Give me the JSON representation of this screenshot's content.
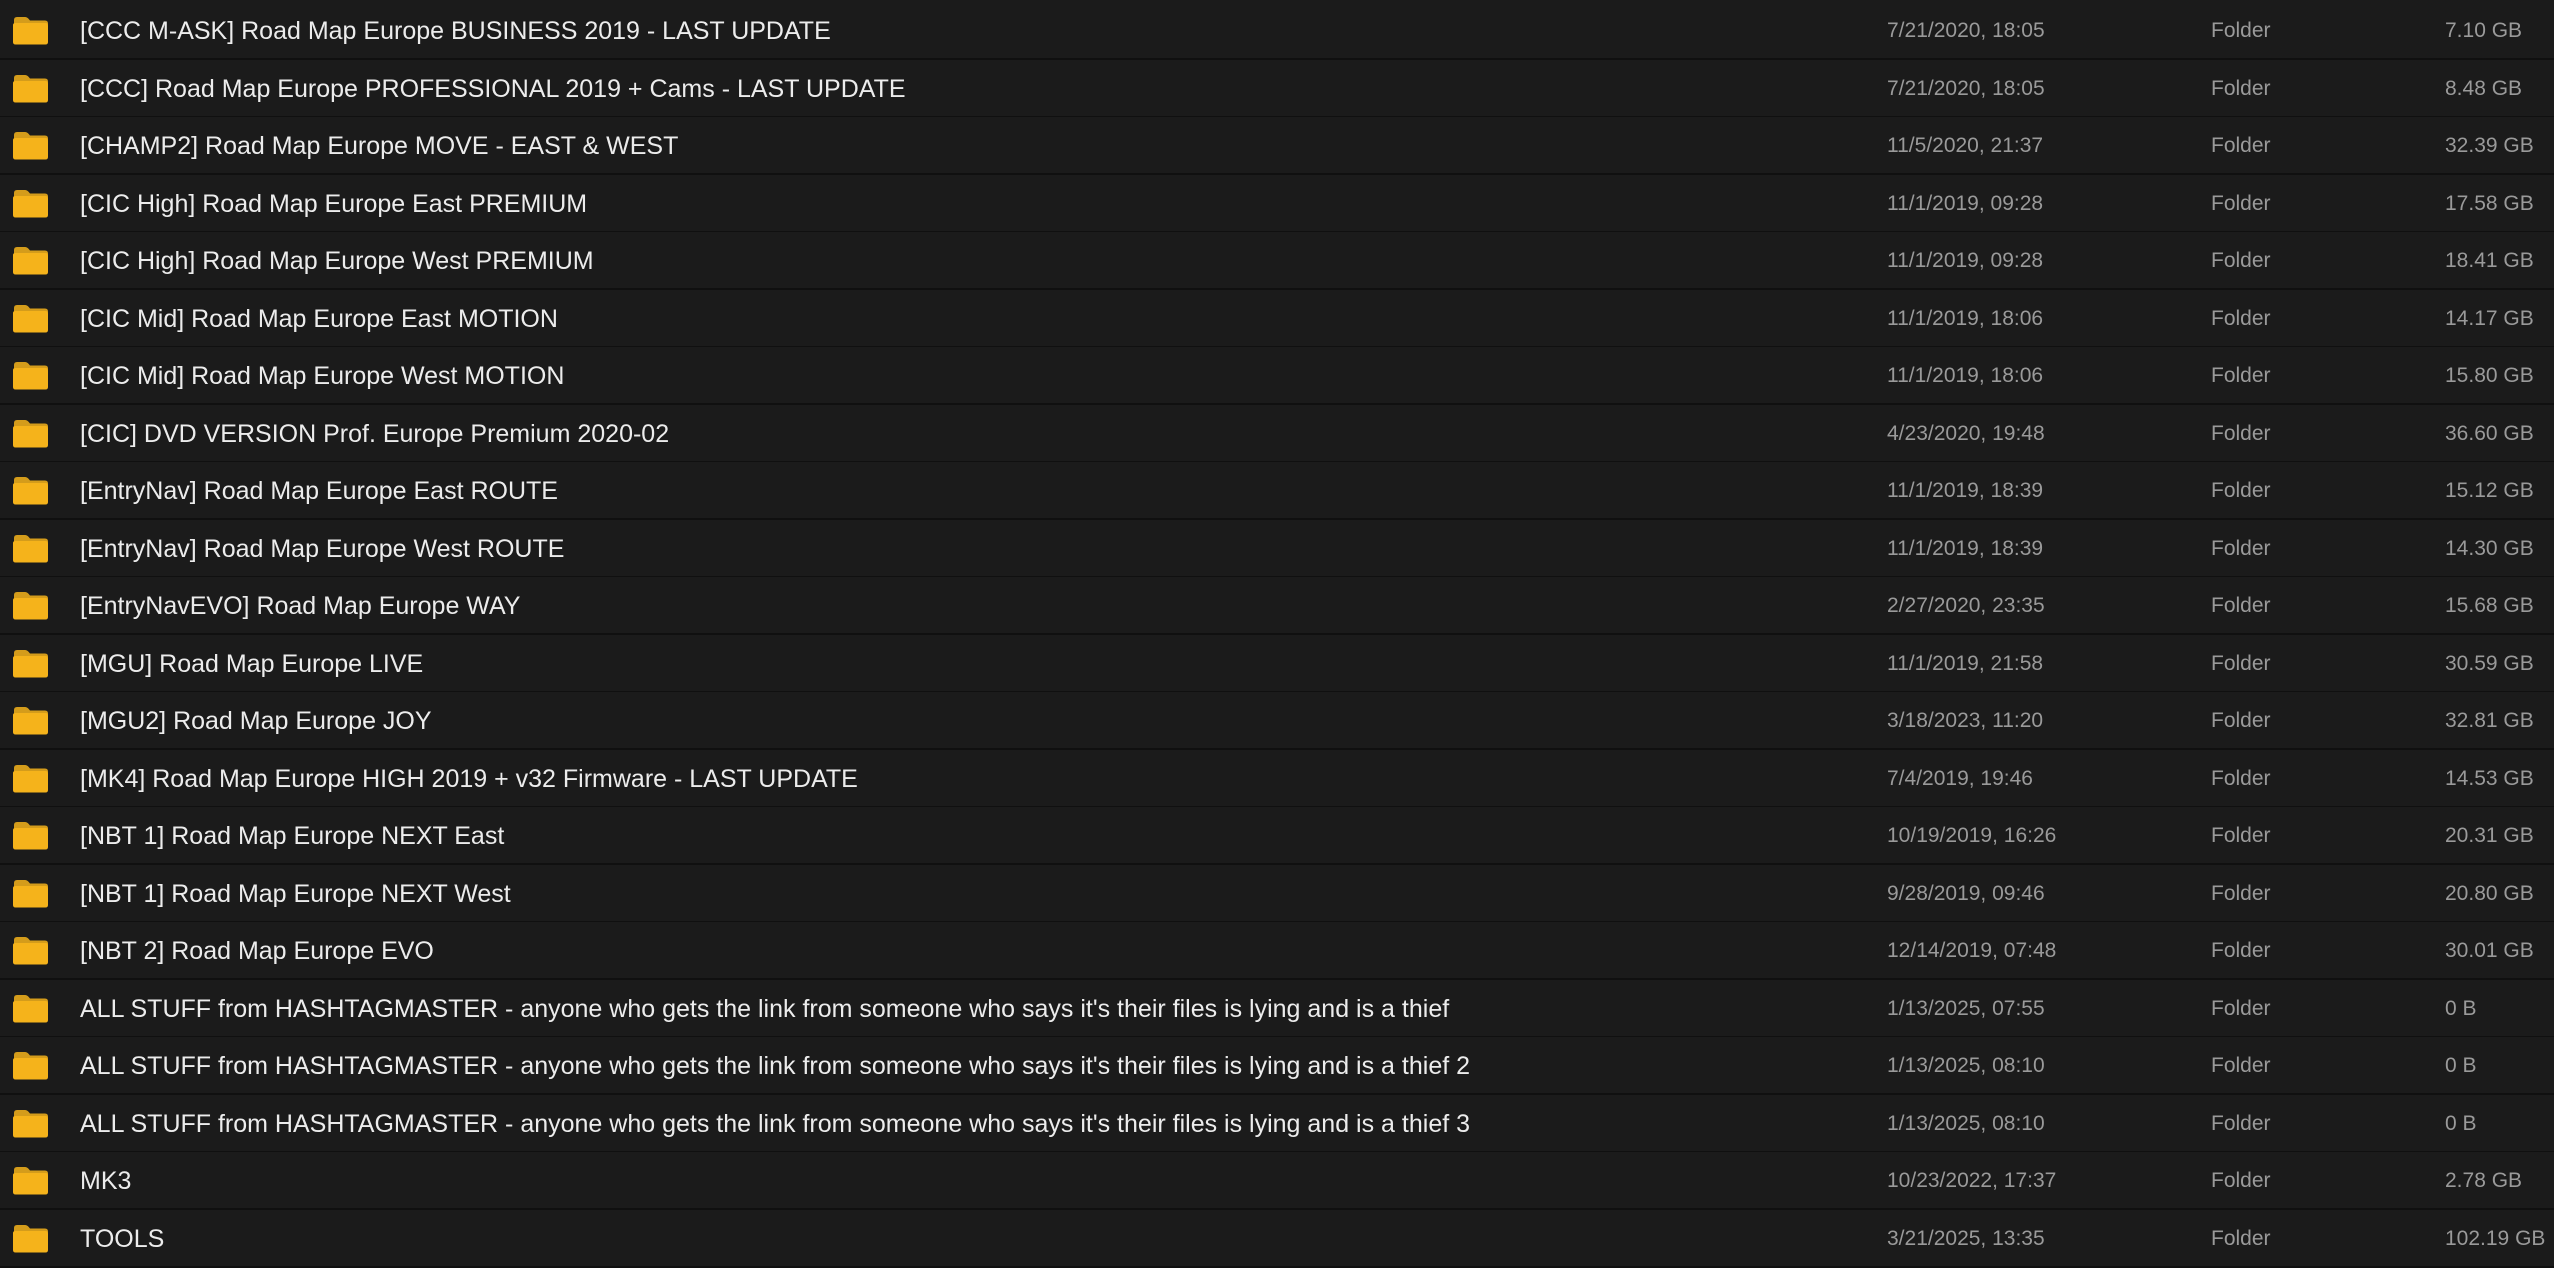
{
  "icons": {
    "folder": "folder-icon"
  },
  "colors": {
    "background": "#1b1b1b",
    "row_divider": "#101010",
    "name_text": "#ececec",
    "meta_text": "#9a9a9a",
    "folder_icon": "#f5b31b"
  },
  "files": [
    {
      "name": "[CCC M-ASK] Road Map Europe BUSINESS 2019 - LAST UPDATE",
      "date": "7/21/2020, 18:05",
      "kind": "Folder",
      "size": "7.10 GB"
    },
    {
      "name": "[CCC] Road Map Europe PROFESSIONAL 2019 + Cams - LAST UPDATE",
      "date": "7/21/2020, 18:05",
      "kind": "Folder",
      "size": "8.48 GB"
    },
    {
      "name": "[CHAMP2] Road Map Europe MOVE - EAST & WEST",
      "date": "11/5/2020, 21:37",
      "kind": "Folder",
      "size": "32.39 GB"
    },
    {
      "name": "[CIC High] Road Map Europe East PREMIUM",
      "date": "11/1/2019, 09:28",
      "kind": "Folder",
      "size": "17.58 GB"
    },
    {
      "name": "[CIC High] Road Map Europe West PREMIUM",
      "date": "11/1/2019, 09:28",
      "kind": "Folder",
      "size": "18.41 GB"
    },
    {
      "name": "[CIC Mid] Road Map Europe East MOTION",
      "date": "11/1/2019, 18:06",
      "kind": "Folder",
      "size": "14.17 GB"
    },
    {
      "name": "[CIC Mid] Road Map Europe West MOTION",
      "date": "11/1/2019, 18:06",
      "kind": "Folder",
      "size": "15.80 GB"
    },
    {
      "name": "[CIC] DVD VERSION Prof. Europe Premium 2020-02",
      "date": "4/23/2020, 19:48",
      "kind": "Folder",
      "size": "36.60 GB"
    },
    {
      "name": "[EntryNav] Road Map Europe East ROUTE",
      "date": "11/1/2019, 18:39",
      "kind": "Folder",
      "size": "15.12 GB"
    },
    {
      "name": "[EntryNav] Road Map Europe West ROUTE",
      "date": "11/1/2019, 18:39",
      "kind": "Folder",
      "size": "14.30 GB"
    },
    {
      "name": "[EntryNavEVO] Road Map Europe WAY",
      "date": "2/27/2020, 23:35",
      "kind": "Folder",
      "size": "15.68 GB"
    },
    {
      "name": "[MGU] Road Map Europe LIVE",
      "date": "11/1/2019, 21:58",
      "kind": "Folder",
      "size": "30.59 GB"
    },
    {
      "name": "[MGU2] Road Map Europe JOY",
      "date": "3/18/2023, 11:20",
      "kind": "Folder",
      "size": "32.81 GB"
    },
    {
      "name": "[MK4] Road Map Europe HIGH 2019 + v32 Firmware - LAST UPDATE",
      "date": "7/4/2019, 19:46",
      "kind": "Folder",
      "size": "14.53 GB"
    },
    {
      "name": "[NBT 1] Road Map Europe NEXT East",
      "date": "10/19/2019, 16:26",
      "kind": "Folder",
      "size": "20.31 GB"
    },
    {
      "name": "[NBT 1] Road Map Europe NEXT West",
      "date": "9/28/2019, 09:46",
      "kind": "Folder",
      "size": "20.80 GB"
    },
    {
      "name": "[NBT 2] Road Map Europe EVO",
      "date": "12/14/2019, 07:48",
      "kind": "Folder",
      "size": "30.01 GB"
    },
    {
      "name": "ALL STUFF from HASHTAGMASTER - anyone who gets the link from someone who says it's their files is lying and is a thief",
      "date": "1/13/2025, 07:55",
      "kind": "Folder",
      "size": "0 B"
    },
    {
      "name": "ALL STUFF from HASHTAGMASTER - anyone who gets the link from someone who says it's their files is lying and is a thief 2",
      "date": "1/13/2025, 08:10",
      "kind": "Folder",
      "size": "0 B"
    },
    {
      "name": "ALL STUFF from HASHTAGMASTER - anyone who gets the link from someone who says it's their files is lying and is a thief 3",
      "date": "1/13/2025, 08:10",
      "kind": "Folder",
      "size": "0 B"
    },
    {
      "name": "MK3",
      "date": "10/23/2022, 17:37",
      "kind": "Folder",
      "size": "2.78 GB"
    },
    {
      "name": "TOOLS",
      "date": "3/21/2025, 13:35",
      "kind": "Folder",
      "size": "102.19 GB"
    }
  ]
}
